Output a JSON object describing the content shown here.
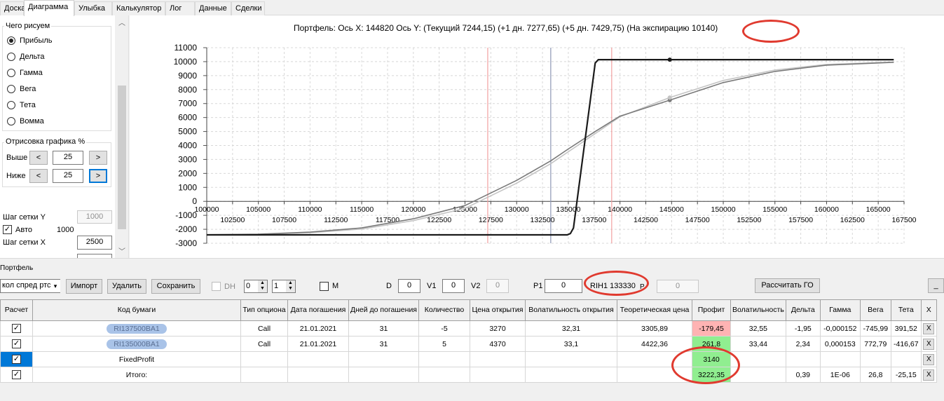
{
  "tabs": [
    "Доска",
    "Диаграмма",
    "Улыбка",
    "Калькулятор",
    "Лог",
    "Данные",
    "Сделки"
  ],
  "active_tab": "Диаграмма",
  "left_panel": {
    "draw_group_label": "Чего рисуем",
    "options": [
      "Прибыль",
      "Дельта",
      "Гамма",
      "Вега",
      "Тета",
      "Вомма"
    ],
    "selected_option": "Прибыль",
    "render_group_label": "Отрисовка графика %",
    "above_label": "Выше",
    "above_value": "25",
    "below_label": "Ниже",
    "below_value": "25",
    "dec_label": "<",
    "inc_label": ">",
    "grid_y_label": "Шаг сетки Y",
    "grid_y_value": "1000",
    "auto_label": "Авто",
    "auto_value": "1000",
    "grid_x_label": "Шаг сетки X",
    "grid_x_value": "2500"
  },
  "chart": {
    "title_prefix": "Портфель: Ось Х: 144820 Ось Y: (Текущий 7244,15) (+1 дн. 7277,65) (+5 дн. 7429,75) (На экспирацию",
    "title_value": "10140)"
  },
  "chart_data": {
    "type": "line",
    "xlim": [
      100000,
      167500
    ],
    "ylim": [
      -3000,
      11000
    ],
    "y_ticks": [
      -3000,
      -2000,
      -1000,
      0,
      1000,
      2000,
      3000,
      4000,
      5000,
      6000,
      7000,
      8000,
      9000,
      10000,
      11000
    ],
    "x_ticks_upper": [
      100000,
      105000,
      110000,
      115000,
      120000,
      125000,
      130000,
      135000,
      140000,
      145000,
      150000,
      155000,
      160000,
      165000
    ],
    "x_ticks_lower": [
      102500,
      107500,
      112500,
      117500,
      122500,
      127500,
      132500,
      137500,
      142500,
      147500,
      152500,
      157500,
      162500,
      167500
    ],
    "vertical_lines": [
      {
        "x": 127200,
        "color": "#f2a0a0"
      },
      {
        "x": 133300,
        "color": "#8c96b4"
      },
      {
        "x": 139200,
        "color": "#f2a0a0"
      }
    ],
    "series": [
      {
        "color": "#1a1a1a",
        "x": [
          100000,
          134900,
          135200,
          135500,
          137600,
          137900,
          166500
        ],
        "y": [
          -2400,
          -2400,
          -2300,
          -1900,
          9900,
          10140,
          10140
        ]
      },
      {
        "color": "#7a7a7a",
        "x": [
          100000,
          105000,
          110000,
          115000,
          120000,
          125000,
          130000,
          133300,
          135000,
          137600,
          140000,
          144820,
          150000,
          155000,
          160000,
          166500
        ],
        "y": [
          -2390,
          -2350,
          -2200,
          -1900,
          -1250,
          -300,
          1500,
          2900,
          3750,
          5000,
          6100,
          7244,
          8500,
          9300,
          9750,
          9950
        ]
      },
      {
        "color": "#c4c4c4",
        "x": [
          100000,
          105000,
          110000,
          115000,
          120000,
          125000,
          130000,
          133300,
          135000,
          137600,
          140000,
          144820,
          150000,
          155000,
          160000,
          166500
        ],
        "y": [
          -2400,
          -2370,
          -2240,
          -1980,
          -1380,
          -500,
          1300,
          2700,
          3550,
          4850,
          6050,
          7430,
          8650,
          9400,
          9800,
          9970
        ]
      }
    ],
    "markers": [
      {
        "x": 144820,
        "y": 10140,
        "color": "#1a1a1a"
      },
      {
        "x": 144820,
        "y": 7244,
        "color": "#7a7a7a"
      },
      {
        "x": 144820,
        "y": 7430,
        "color": "#c4c4c4"
      }
    ]
  },
  "portfolio": {
    "label": "Портфель",
    "combo_value": "кол спред ртс",
    "import_label": "Импорт",
    "delete_label": "Удалить",
    "save_label": "Сохранить",
    "dh_label": "DH",
    "spin1": "0",
    "spin2": "1",
    "m_label": "M",
    "d_label": "D",
    "d_value": "0",
    "v1_label": "V1",
    "v1_value": "0",
    "v2_label": "V2",
    "v2_value": "0",
    "p1_label": "P1",
    "p1_value": "0",
    "instrument": "RIH1 133330",
    "p_label": "P",
    "p_value": "0",
    "calc_go_label": "Рассчитать ГО",
    "minimize_label": "_"
  },
  "table": {
    "headers": [
      "Расчет",
      "Код бумаги",
      "Тип опциона",
      "Дата погашения",
      "Дней до погашения",
      "Количество",
      "Цена открытия",
      "Волатильность открытия",
      "Теоретическая цена",
      "Профит",
      "Волатильность",
      "Дельта",
      "Гамма",
      "Вега",
      "Тета",
      "X"
    ],
    "rows": [
      {
        "code": "RI137500BA1",
        "type": "Call",
        "date": "21.01.2021",
        "days": "31",
        "qty": "-5",
        "open_price": "3270",
        "open_vol": "32,31",
        "theo": "3305,89",
        "profit": "-179,45",
        "vol": "32,55",
        "delta": "-1,95",
        "gamma": "-0,000152",
        "vega": "-745,99",
        "theta": "391,52"
      },
      {
        "code": "RI135000BA1",
        "type": "Call",
        "date": "21.01.2021",
        "days": "31",
        "qty": "5",
        "open_price": "4370",
        "open_vol": "33,1",
        "theo": "4422,36",
        "profit": "261,8",
        "vol": "33,44",
        "delta": "2,34",
        "gamma": "0,000153",
        "vega": "772,79",
        "theta": "-416,67"
      },
      {
        "code": "FixedProfit",
        "profit": "3140"
      },
      {
        "code": "Итого:",
        "profit": "3222,35",
        "delta": "0,39",
        "gamma": "1E-06",
        "vega": "26,8",
        "theta": "-25,15"
      }
    ],
    "x_label": "X"
  }
}
